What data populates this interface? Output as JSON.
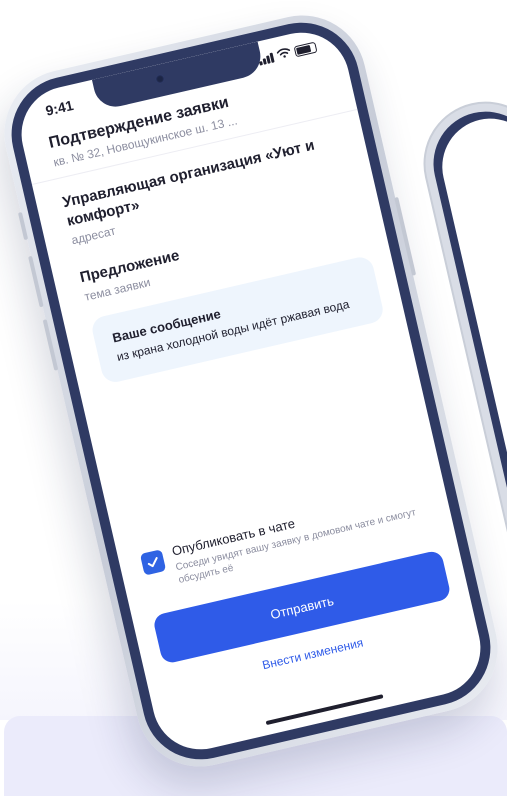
{
  "status_bar": {
    "time": "9:41"
  },
  "header": {
    "title": "Подтверждение заявки",
    "subtitle": "кв. № 32, Новощукинское ш. 13 ..."
  },
  "recipient": {
    "name": "Управляющая организация «Уют и комфорт»",
    "caption": "адресат"
  },
  "topic": {
    "value": "Предложение",
    "caption": "тема заявки"
  },
  "message": {
    "title": "Ваше сообщение",
    "text": "из крана холодной воды идёт ржавая вода"
  },
  "publish": {
    "checked": true,
    "title": "Опубликовать в чате",
    "hint": "Соседи увидят вашу заявку в домовом чате и смогут обсудить её"
  },
  "actions": {
    "send_label": "Отправить",
    "edit_label": "Внести изменения"
  },
  "icons": {
    "signal": "signal-icon",
    "wifi": "wifi-icon",
    "battery": "battery-icon",
    "check": "check-icon"
  },
  "colors": {
    "accent": "#2f5be8",
    "phone_bezel": "#2f3a63",
    "card_bg": "#eef5fd"
  }
}
